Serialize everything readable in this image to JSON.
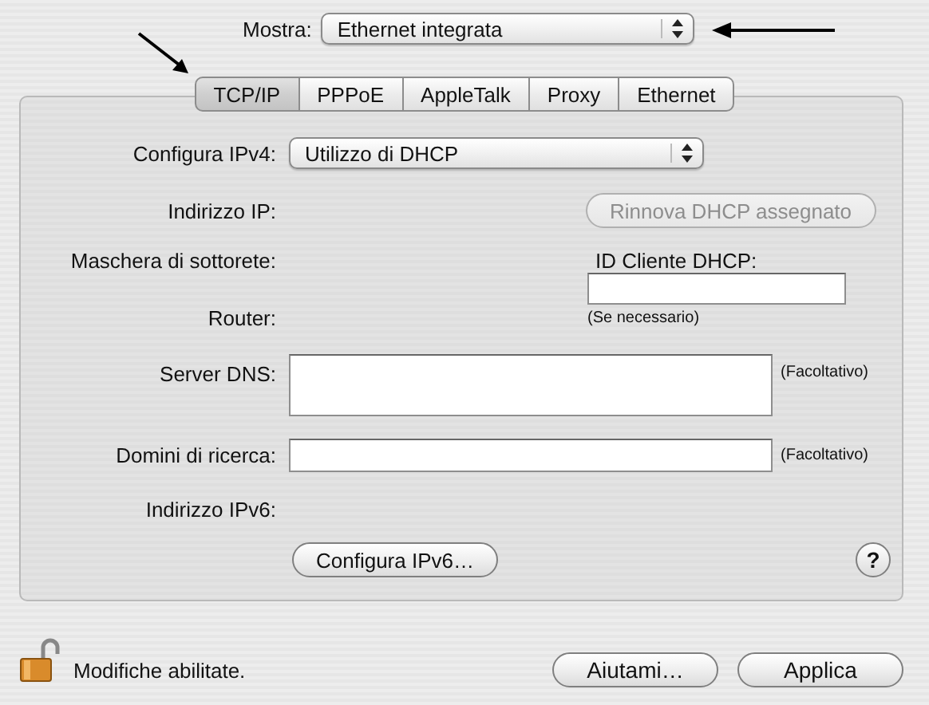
{
  "show": {
    "label": "Mostra:",
    "value": "Ethernet integrata"
  },
  "tabs": [
    {
      "label": "TCP/IP",
      "selected": true
    },
    {
      "label": "PPPoE",
      "selected": false
    },
    {
      "label": "AppleTalk",
      "selected": false
    },
    {
      "label": "Proxy",
      "selected": false
    },
    {
      "label": "Ethernet",
      "selected": false
    }
  ],
  "form": {
    "configure_ipv4": {
      "label": "Configura IPv4:",
      "value": "Utilizzo di DHCP"
    },
    "ip_address": {
      "label": "Indirizzo IP:"
    },
    "renew_button": {
      "label": "Rinnova DHCP assegnato",
      "disabled": true
    },
    "subnet_mask": {
      "label": "Maschera di sottorete:"
    },
    "dhcp_client_id": {
      "label": "ID Cliente DHCP:",
      "note": "(Se necessario)"
    },
    "router": {
      "label": "Router:"
    },
    "dns_servers": {
      "label": "Server DNS:",
      "note": "(Facoltativo)"
    },
    "search_domains": {
      "label": "Domini di ricerca:",
      "note": "(Facoltativo)"
    },
    "ipv6_address": {
      "label": "Indirizzo IPv6:"
    },
    "configure_ipv6_button": "Configura IPv6…",
    "help_button": "?"
  },
  "lock": {
    "locked": false,
    "label": "Modifiche abilitate."
  },
  "buttons": [
    "Aiutami…",
    "Applica"
  ]
}
